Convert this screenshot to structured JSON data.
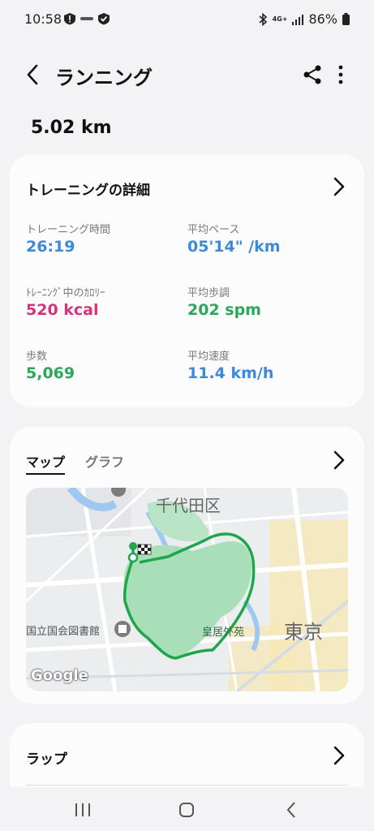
{
  "status_bar": {
    "time": "10:58",
    "battery": "86%",
    "network": "4G+",
    "icons": [
      "warning-icon",
      "app-notification-icon",
      "shield-check-icon",
      "bluetooth-icon",
      "network-data-icon",
      "signal-icon",
      "battery-icon"
    ]
  },
  "header": {
    "title": "ランニング",
    "back_icon": "back-arrow-icon",
    "share_icon": "share-icon",
    "more_icon": "more-vertical-icon"
  },
  "summary": {
    "distance": "5.02 km"
  },
  "details": {
    "title": "トレーニングの詳細",
    "metrics": [
      {
        "label": "トレーニング時間",
        "value": "26:19",
        "color": "#3d8ad6"
      },
      {
        "label": "平均ペース",
        "value": "05'14\" /km",
        "color": "#3d8ad6"
      },
      {
        "label": "ﾄﾚｰﾆﾝｸﾞ中のｶﾛﾘｰ",
        "value": "520 kcal",
        "color": "#d6337a"
      },
      {
        "label": "平均歩調",
        "value": "202 spm",
        "color": "#2aa85a"
      },
      {
        "label": "歩数",
        "value": "5,069",
        "color": "#2aa85a"
      },
      {
        "label": "平均速度",
        "value": "11.4 km/h",
        "color": "#3d8ad6"
      }
    ]
  },
  "map_card": {
    "tabs": [
      {
        "label": "マップ",
        "active": true
      },
      {
        "label": "グラフ",
        "active": false
      }
    ],
    "map_labels": {
      "district": "千代田区",
      "library": "国立国会図書館",
      "garden": "皇居外苑",
      "city": "東京",
      "attribution": "Google"
    },
    "route_color": "#1fa64a",
    "park_color": "#a8dfb8"
  },
  "laps": {
    "title": "ラップ"
  },
  "nav_bar": {
    "icons": [
      "recent-apps-icon",
      "home-icon",
      "back-icon"
    ]
  }
}
